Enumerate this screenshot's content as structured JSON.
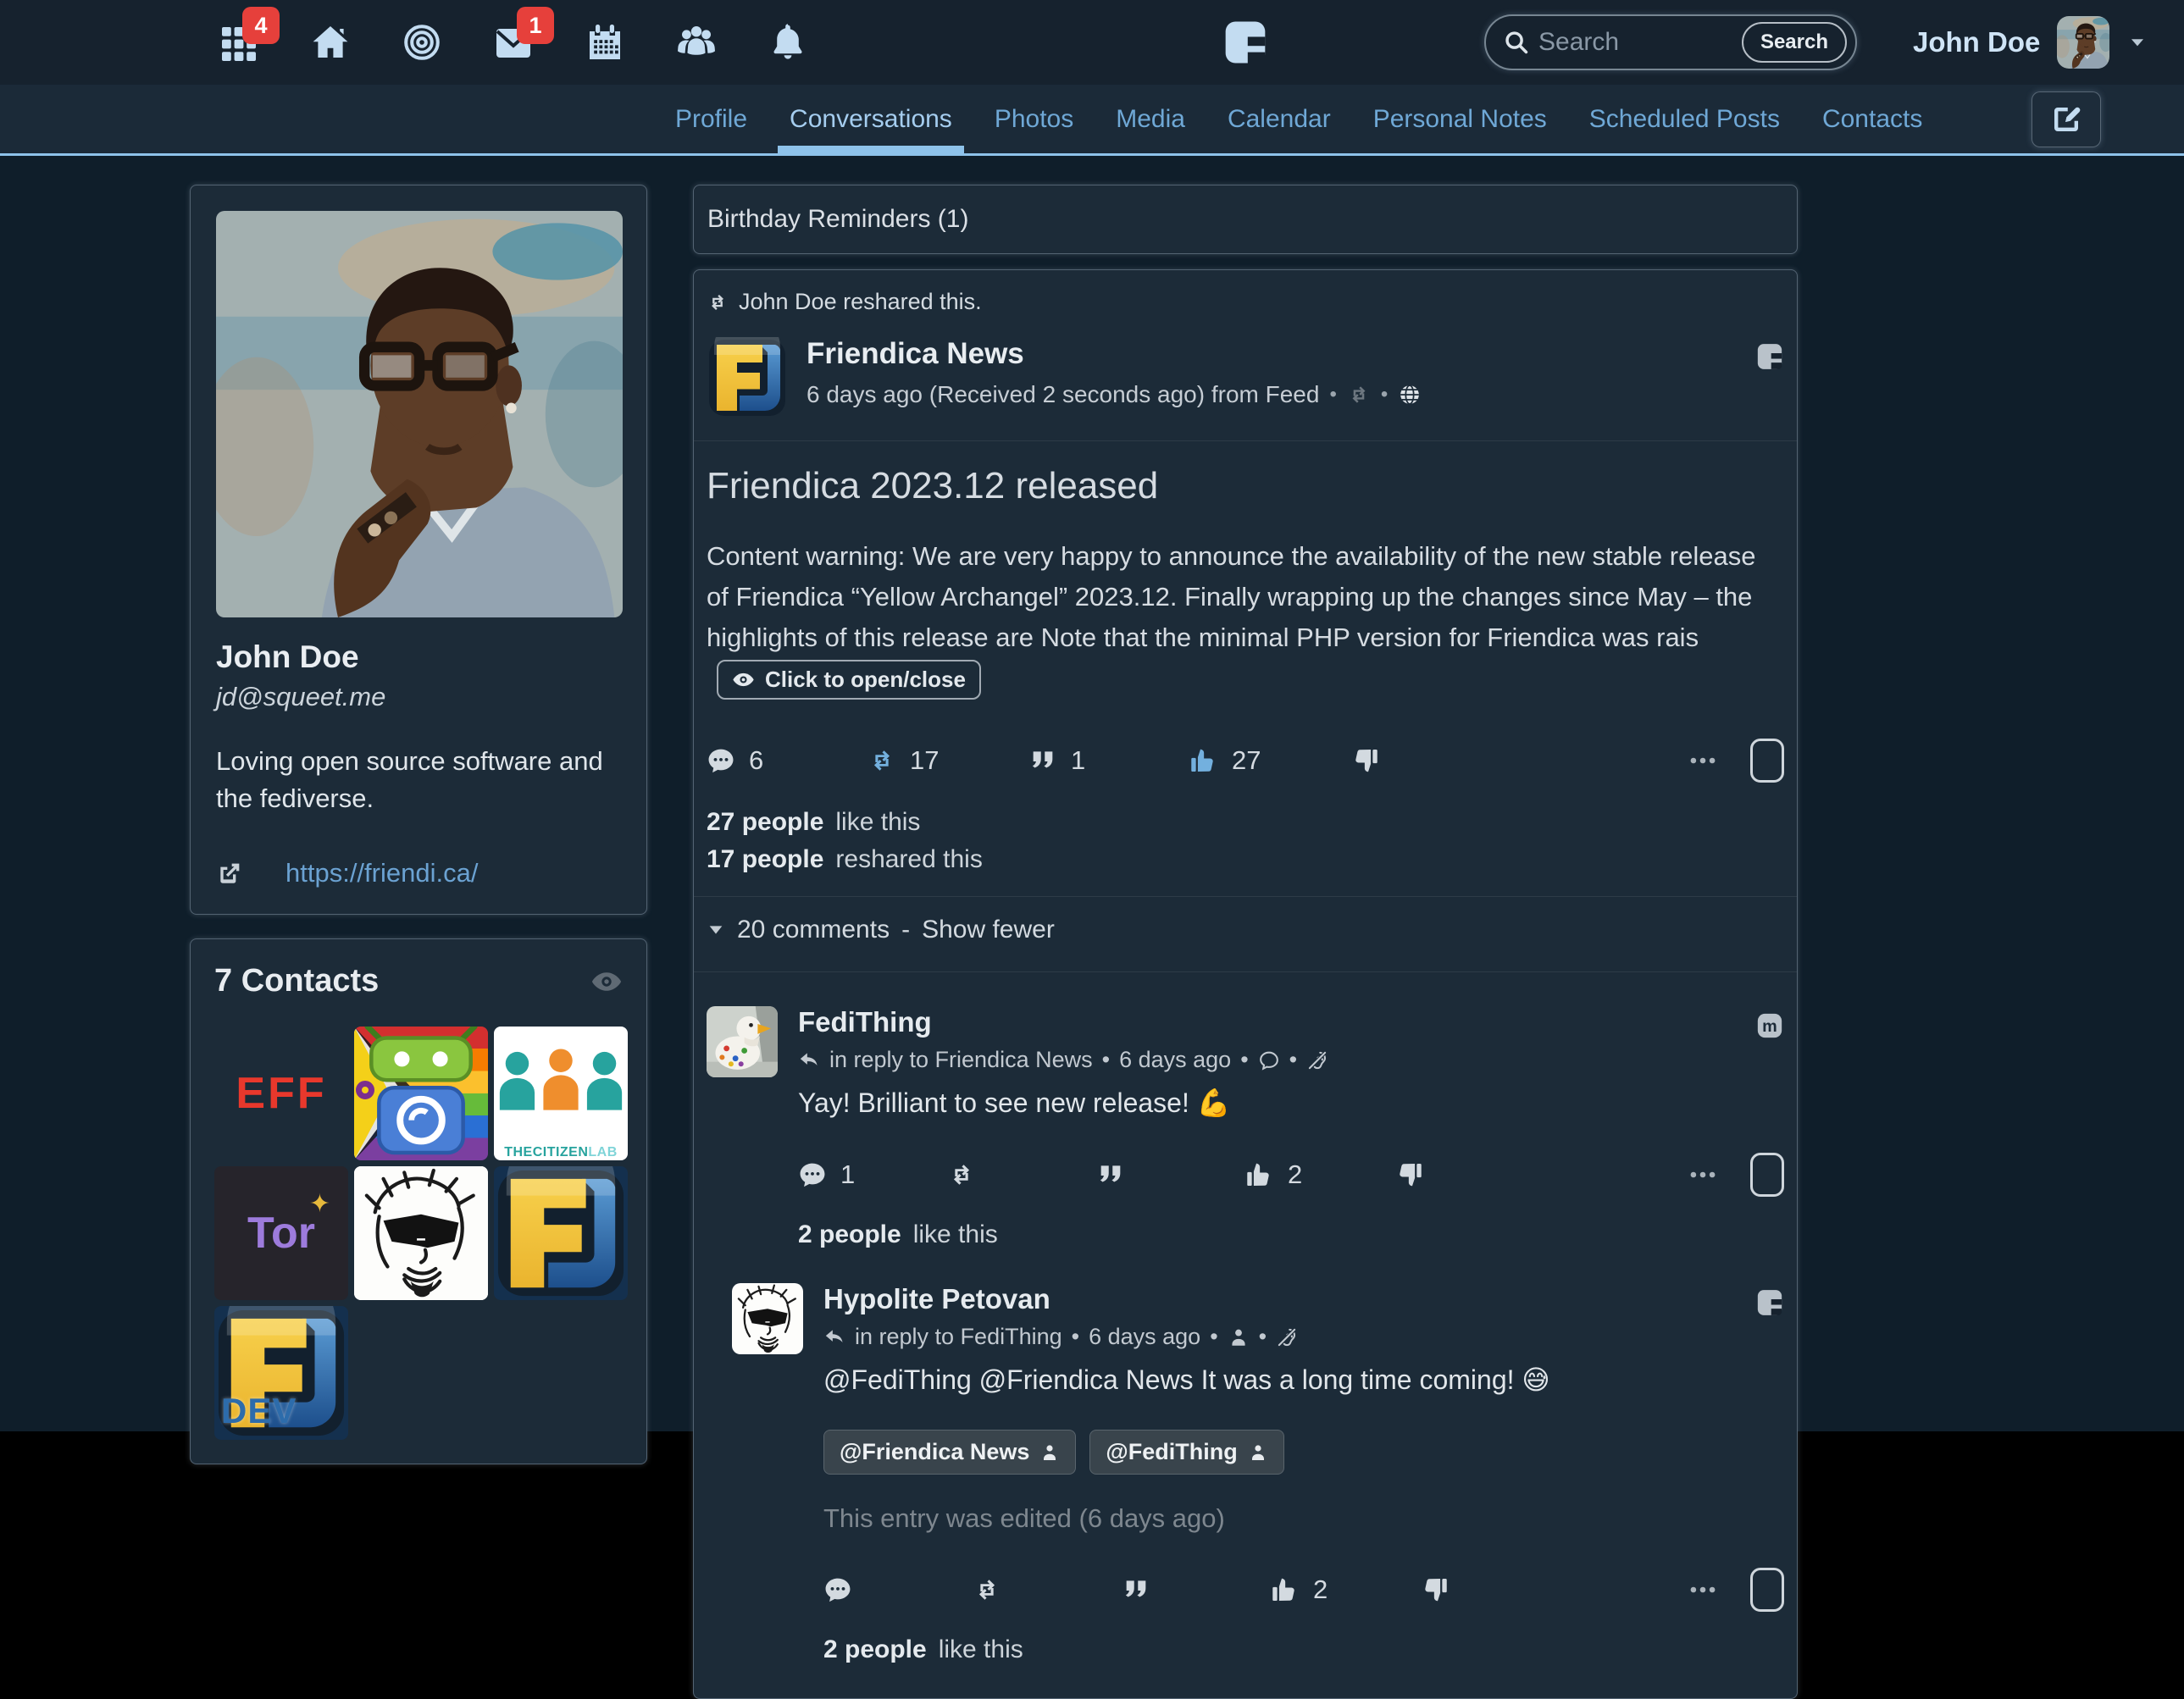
{
  "ui": {
    "dot": "•",
    "dash": "-"
  },
  "colors": {
    "accent": "#8ec2ea",
    "badge": "#e6403b",
    "link": "#6ba2d2",
    "action_blue": "#73b0de",
    "page_bg": "#0f1e2a",
    "card_bg": "#1c2b38"
  },
  "navbar": {
    "badges": {
      "apps": "4",
      "messages": "1"
    },
    "search": {
      "placeholder": "Search",
      "button_label": "Search"
    },
    "user_name": "John Doe"
  },
  "tabs": {
    "items": [
      {
        "label": "Profile"
      },
      {
        "label": "Conversations"
      },
      {
        "label": "Photos"
      },
      {
        "label": "Media"
      },
      {
        "label": "Calendar"
      },
      {
        "label": "Personal Notes"
      },
      {
        "label": "Scheduled Posts"
      },
      {
        "label": "Contacts"
      }
    ],
    "active": "Conversations"
  },
  "sidebar": {
    "profile": {
      "name": "John Doe",
      "handle": "jd@squeet.me",
      "bio": "Loving open source software and the fediverse.",
      "link": "https://friendi.ca/"
    },
    "contacts": {
      "title": "7 Contacts",
      "tiles": [
        {
          "name": "eff",
          "text": "EFF"
        },
        {
          "name": "fdroid-pride"
        },
        {
          "name": "citizen-lab",
          "text_main": "THECITIZEN",
          "text_sub": "LAB"
        },
        {
          "name": "tor",
          "text": "Tor"
        },
        {
          "name": "sketch-portrait"
        },
        {
          "name": "friendica"
        },
        {
          "name": "friendica-dev",
          "text": "DEV"
        }
      ]
    }
  },
  "feed": {
    "birthday_banner": "Birthday Reminders (1)",
    "post": {
      "reshare_note": "John Doe reshared this.",
      "author": "Friendica News",
      "meta": "6 days ago (Received 2 seconds ago) from Feed",
      "title": "Friendica 2023.12 released",
      "body": "Content warning: We are very happy to announce the availability of the new stable release of Friendica “Yellow Archangel” 2023.12. Finally wrapping up the changes since May – the highlights of this release are Note that the minimal PHP version for Friendica was rais",
      "toggle_label": "Click to open/close",
      "counts": {
        "comments": "6",
        "reshares": "17",
        "quotes": "1",
        "likes": "27"
      },
      "likes_line": {
        "strong": "27 people",
        "rest": "like this"
      },
      "reshares_line": {
        "strong": "17 people",
        "rest": "reshared this"
      },
      "comments_toggle": {
        "label": "20 comments",
        "action": "Show fewer"
      }
    },
    "comments": [
      {
        "author": "FediThing",
        "reply_to": "in reply to Friendica News",
        "time": "6 days ago",
        "text": "Yay! Brilliant to see new release! 💪",
        "counts": {
          "comments": "1",
          "likes": "2"
        },
        "likes_line": {
          "strong": "2 people",
          "rest": "like this"
        }
      },
      {
        "author": "Hypolite Petovan",
        "reply_to": "in reply to FediThing",
        "time": "6 days ago",
        "text": "@FediThing @Friendica News It was a long time coming! 😅",
        "tags": [
          "@Friendica News",
          "@FediThing"
        ],
        "edited": "This entry was edited (6 days ago)",
        "counts": {
          "likes": "2"
        },
        "likes_line": {
          "strong": "2 people",
          "rest": "like this"
        }
      }
    ]
  },
  "icons": {
    "apps": "grid-icon",
    "home": "home-icon",
    "network": "bullseye-icon",
    "messages": "mail-icon",
    "calendar": "calendar-icon",
    "groups": "people-icon",
    "notifications": "bell-icon",
    "logo": "friendica-logo",
    "search": "magnifier-icon",
    "user_menu": "caret-down-icon",
    "compose": "pencil-square-icon",
    "visibility": "eye-icon",
    "website": "external-link-icon",
    "reshare": "retweet-icon",
    "comment": "speech-bubble-icon",
    "quote": "double-quote-icon",
    "like": "thumbs-up-icon",
    "dislike": "thumbs-down-icon",
    "more": "ellipsis-icon",
    "select": "checkbox",
    "reply": "reply-arrow-icon",
    "public": "globe-icon",
    "muted": "ear-slash-icon",
    "person": "person-icon",
    "mastodon": "mastodon-icon",
    "friendica": "friendica-f-icon"
  }
}
